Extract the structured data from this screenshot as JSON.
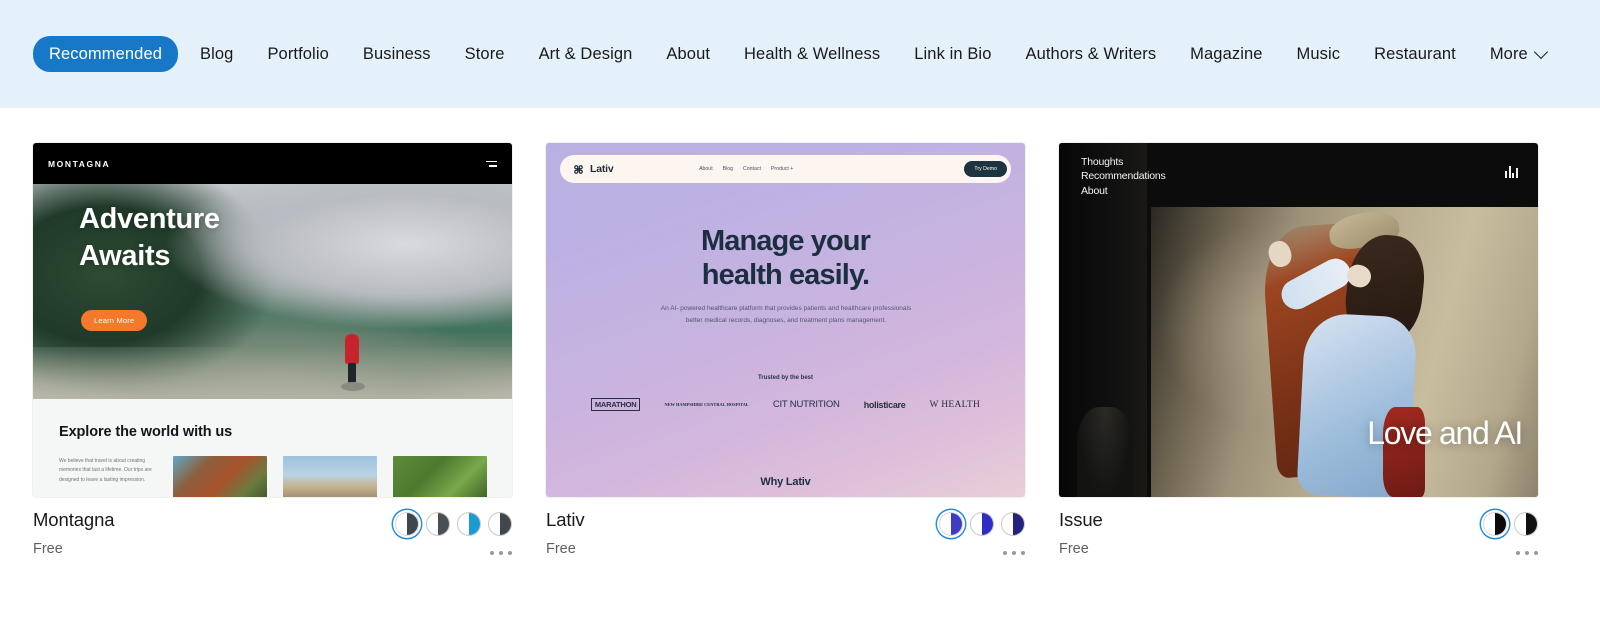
{
  "category_nav": {
    "items": [
      {
        "label": "Recommended",
        "active": true
      },
      {
        "label": "Blog",
        "active": false
      },
      {
        "label": "Portfolio",
        "active": false
      },
      {
        "label": "Business",
        "active": false
      },
      {
        "label": "Store",
        "active": false
      },
      {
        "label": "Art & Design",
        "active": false
      },
      {
        "label": "About",
        "active": false
      },
      {
        "label": "Health & Wellness",
        "active": false
      },
      {
        "label": "Link in Bio",
        "active": false
      },
      {
        "label": "Authors & Writers",
        "active": false
      },
      {
        "label": "Magazine",
        "active": false
      },
      {
        "label": "Music",
        "active": false
      },
      {
        "label": "Restaurant",
        "active": false
      },
      {
        "label": "More",
        "active": false
      }
    ],
    "more_label": "More",
    "accent_color": "#1878c8",
    "background_color": "#e4f1fb"
  },
  "templates": [
    {
      "name": "Montagna",
      "price": "Free",
      "preview": {
        "logo": "MONTAGNA",
        "hero_title_line1": "Adventure",
        "hero_title_line2": "Awaits",
        "hero_button": "Learn More",
        "section_title": "Explore the world with us",
        "section_paragraph": "We believe that travel is about creating memories that last a lifetime. Our trips are designed to leave a lasting impression."
      },
      "swatches": [
        {
          "color": "#3e4650",
          "selected": true
        },
        {
          "color": "#4a4f56",
          "selected": false
        },
        {
          "color": "#1b9ad4",
          "selected": false
        },
        {
          "color": "#42474d",
          "selected": false
        }
      ],
      "more_options": "..."
    },
    {
      "name": "Lativ",
      "price": "Free",
      "preview": {
        "logo": "Lativ",
        "nav_links": [
          "About",
          "Blog",
          "Contact",
          "Product +"
        ],
        "cta_button": "Try Demo",
        "hero_title_line1": "Manage your",
        "hero_title_line2": "health easily.",
        "hero_subtitle": "An AI- powered healthcare platform that provides patients and healthcare professionals better medical records, diagnoses, and treatment plans management.",
        "trusted_label": "Trusted by the best",
        "client_logos": [
          "MARATHON",
          "NEW HAMPSHIRE CENTRAL HOSPITAL",
          "CIT NUTRITION",
          "holisticare",
          "W HEALTH"
        ],
        "next_section": "Why Lativ"
      },
      "swatches": [
        {
          "color": "#3d3bc4",
          "selected": true
        },
        {
          "color": "#2e2ec6",
          "selected": false
        },
        {
          "color": "#23237e",
          "selected": false
        }
      ],
      "more_options": "..."
    },
    {
      "name": "Issue",
      "price": "Free",
      "preview": {
        "nav_links": [
          "Thoughts",
          "Recommendations",
          "About"
        ],
        "hero_title": "Love and AI"
      },
      "swatches": [
        {
          "color": "#0b0b0b",
          "selected": true
        },
        {
          "color": "#101010",
          "selected": false
        }
      ],
      "more_options": "..."
    }
  ]
}
